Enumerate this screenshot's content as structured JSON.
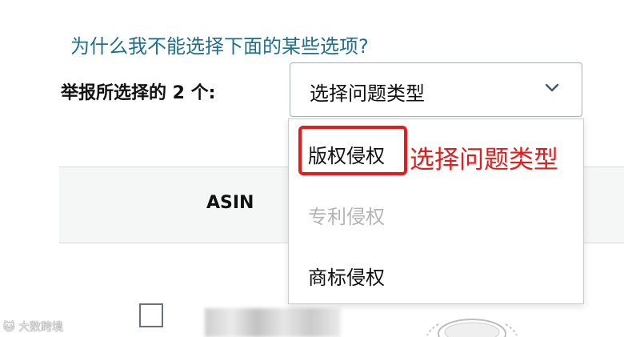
{
  "help_link": "为什么我不能选择下面的某些选项?",
  "report_label": "举报所选择的 2 个:",
  "issue_select": {
    "value": "选择问题类型",
    "icon": "chevron-down-icon"
  },
  "dropdown": {
    "options": [
      {
        "label": "版权侵权",
        "enabled": true
      },
      {
        "label": "专利侵权",
        "enabled": false
      },
      {
        "label": "商标侵权",
        "enabled": true
      }
    ]
  },
  "annotation_text": "选择问题类型",
  "table": {
    "header_asin": "ASIN"
  },
  "watermark": "🐱 大数跨境",
  "colors": {
    "link": "#1f6f8b",
    "annotation_red": "#e51c1c",
    "disabled_text": "#b5b5b5",
    "border": "#aab0b7"
  }
}
